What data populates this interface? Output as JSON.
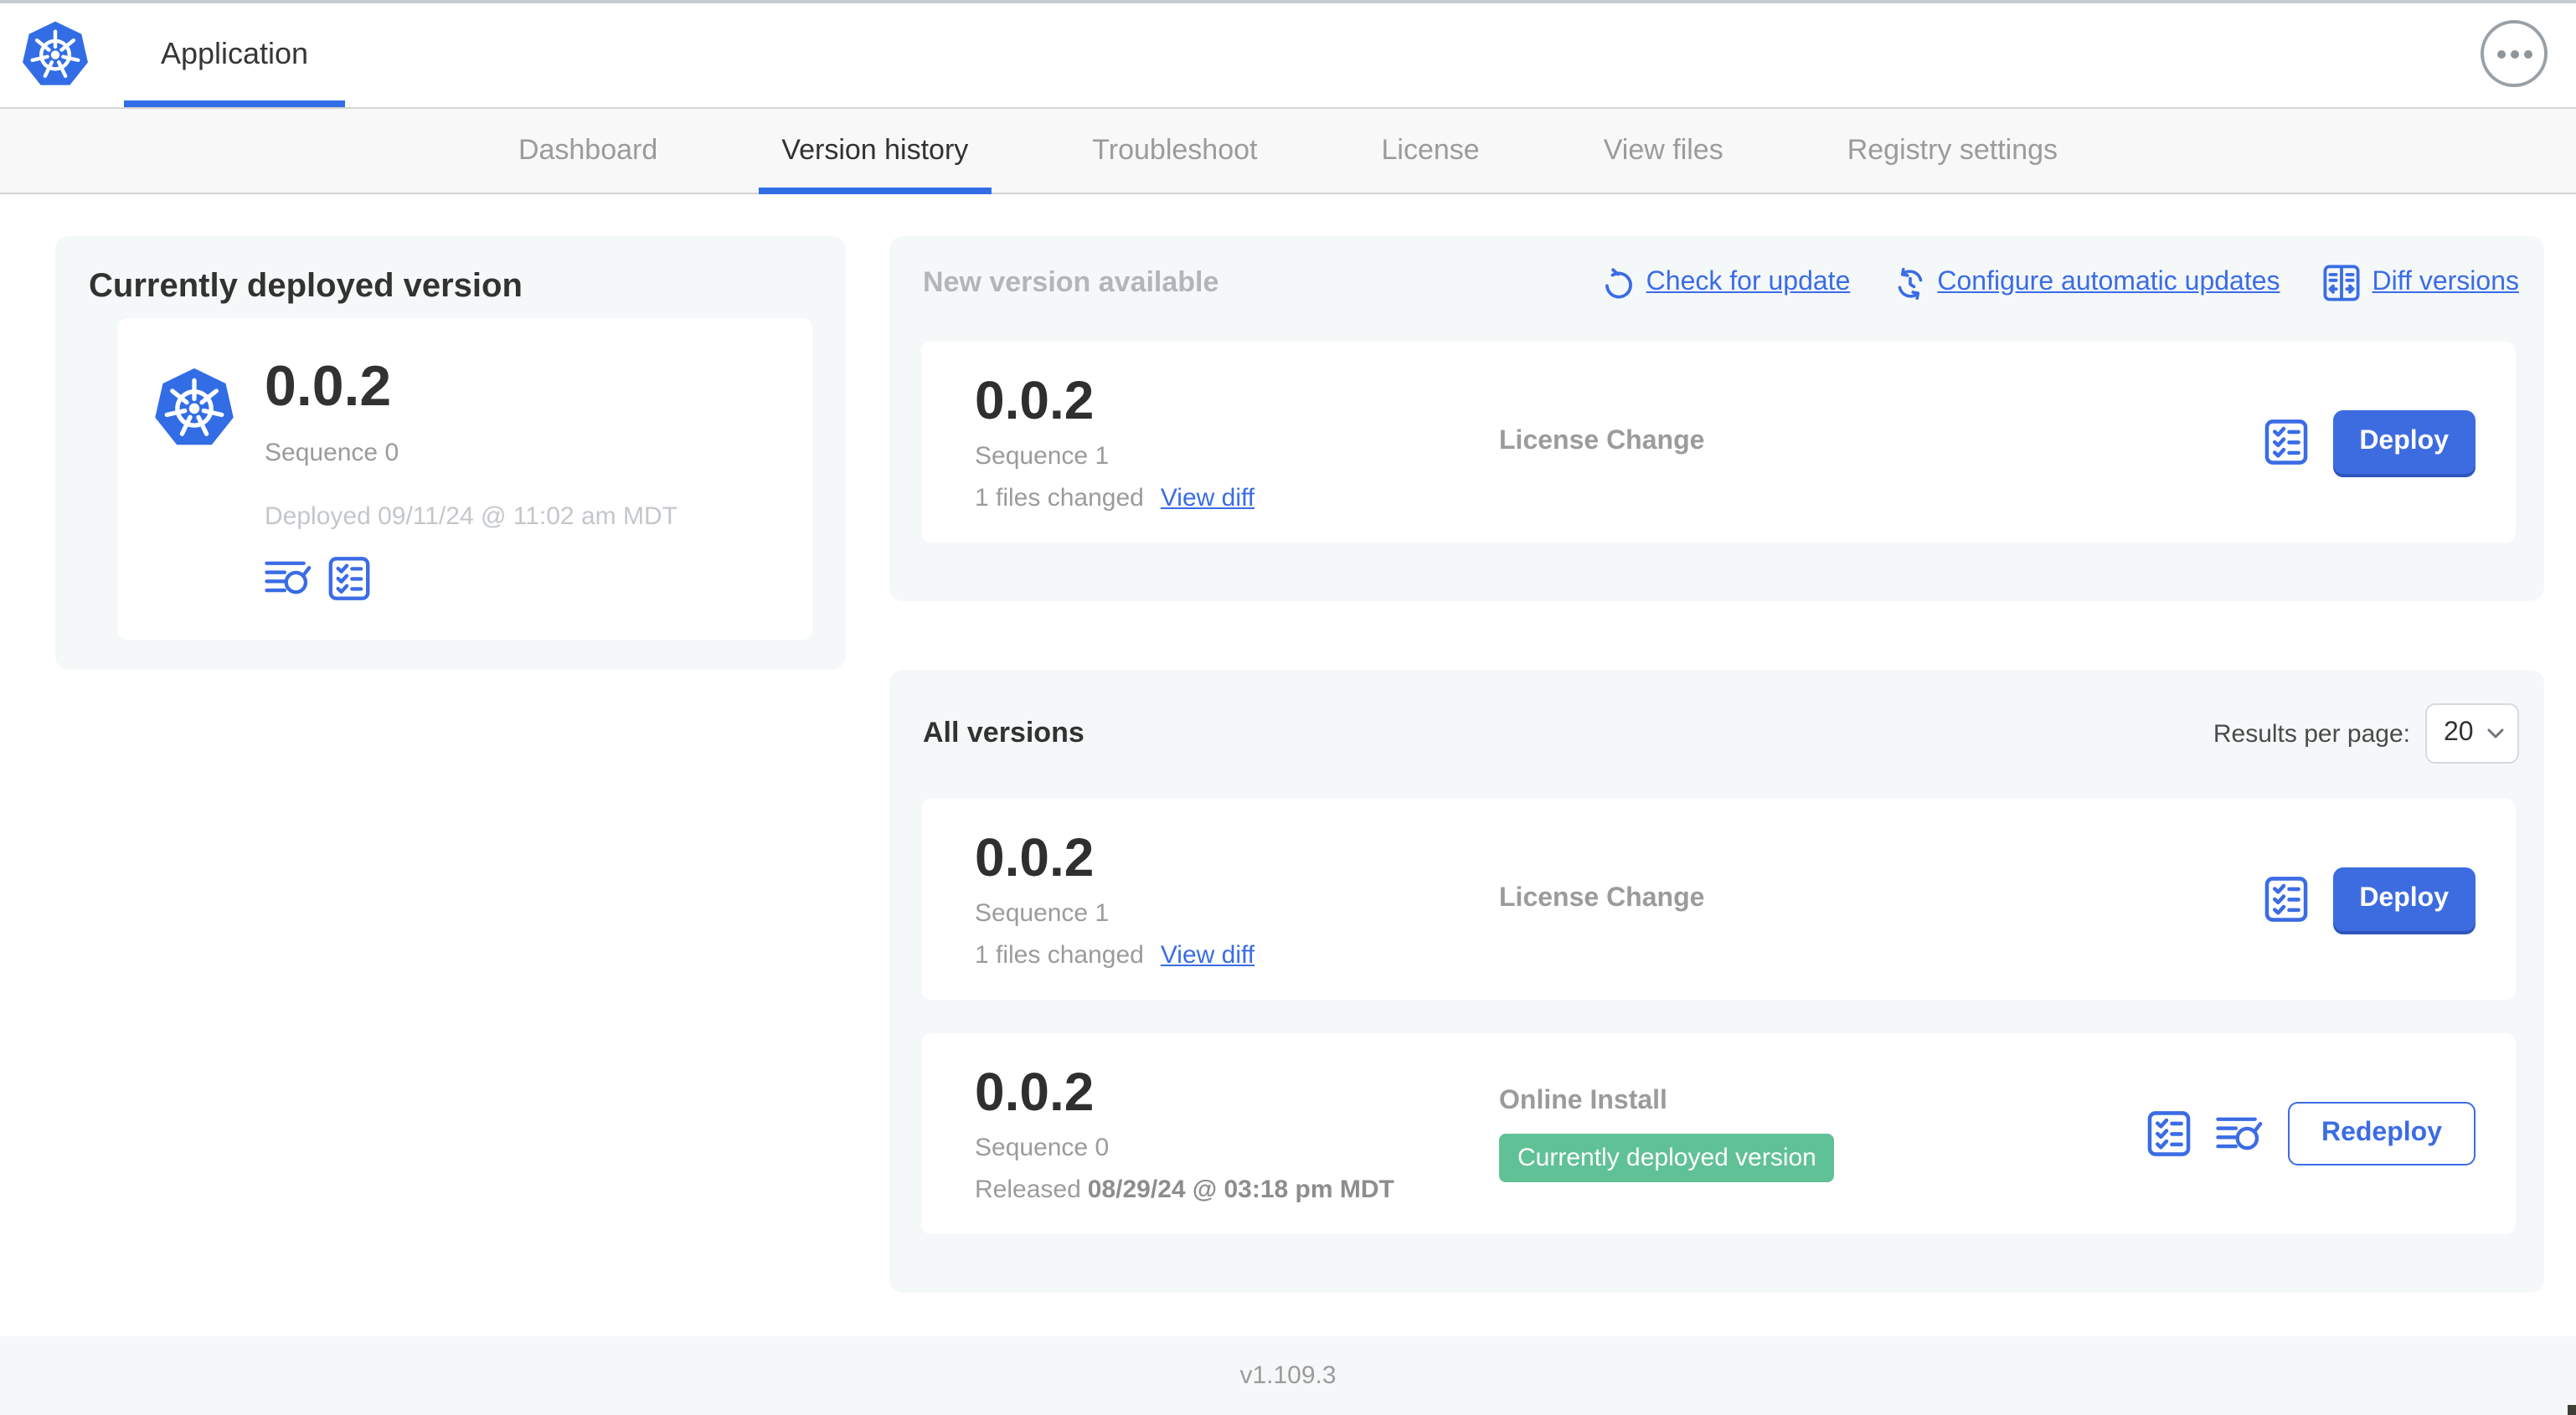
{
  "header": {
    "app_tab_label": "Application"
  },
  "nav": {
    "tabs": [
      {
        "label": "Dashboard",
        "active": false
      },
      {
        "label": "Version history",
        "active": true
      },
      {
        "label": "Troubleshoot",
        "active": false
      },
      {
        "label": "License",
        "active": false
      },
      {
        "label": "View files",
        "active": false
      },
      {
        "label": "Registry settings",
        "active": false
      }
    ]
  },
  "current_version_card": {
    "title": "Currently deployed version",
    "version": "0.0.2",
    "sequence": "Sequence 0",
    "deployed": "Deployed 09/11/24 @ 11:02 am MDT"
  },
  "new_version_section": {
    "title": "New version available",
    "actions": [
      {
        "label": "Check for update",
        "icon": "refresh-icon"
      },
      {
        "label": "Configure automatic updates",
        "icon": "schedule-icon"
      },
      {
        "label": "Diff versions",
        "icon": "diff-icon"
      }
    ],
    "row": {
      "version": "0.0.2",
      "sequence": "Sequence 1",
      "files_changed": "1 files changed",
      "view_diff_label": "View diff",
      "source": "License Change",
      "deploy_label": "Deploy"
    }
  },
  "all_versions_section": {
    "title": "All versions",
    "results_per_page_label": "Results per page:",
    "results_per_page_value": "20",
    "rows": [
      {
        "version": "0.0.2",
        "sequence": "Sequence 1",
        "files_changed": "1 files changed",
        "view_diff_label": "View diff",
        "source": "License Change",
        "action_label": "Deploy"
      },
      {
        "version": "0.0.2",
        "sequence": "Sequence 0",
        "released_prefix": "Released",
        "released_date": "08/29/24 @ 03:18 pm MDT",
        "source": "Online Install",
        "badge": "Currently deployed version",
        "action_label": "Redeploy"
      }
    ]
  },
  "footer": {
    "version": "v1.109.3"
  },
  "colors": {
    "accent_blue": "#3b6ce5",
    "k8s_blue": "#326de6",
    "badge_green": "#61c196",
    "card_bg": "#f5f8f9",
    "nav_bg": "#f8f8f8"
  }
}
